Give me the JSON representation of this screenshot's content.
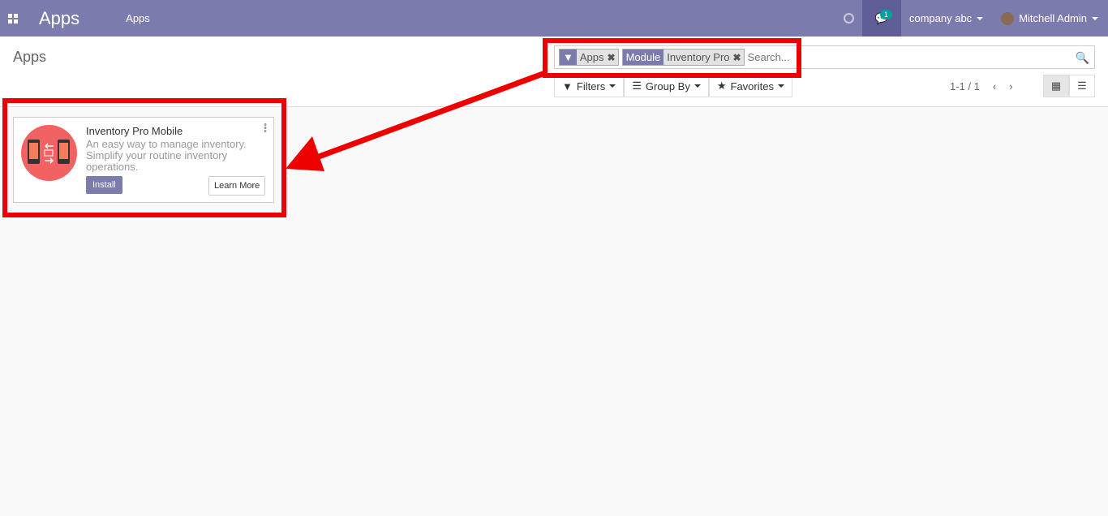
{
  "navbar": {
    "brand": "Apps",
    "menu": [
      "Apps"
    ],
    "chat_badge": "1",
    "company": "company abc",
    "user": "Mitchell Admin"
  },
  "control_panel": {
    "title": "Apps",
    "facets": [
      {
        "icon": "filter-icon",
        "value": "Apps"
      },
      {
        "key": "Module",
        "value": "Inventory Pro"
      }
    ],
    "search_placeholder": "Search...",
    "buttons": {
      "filters": "Filters",
      "group_by": "Group By",
      "favorites": "Favorites"
    },
    "pager": "1-1 / 1"
  },
  "card": {
    "title": "Inventory Pro Mobile",
    "description": "An easy way to manage inventory. Simplify your routine inventory operations.",
    "install": "Install",
    "learn_more": "Learn More"
  },
  "colors": {
    "brand": "#7c7bad",
    "annotation": "#ee0000",
    "logo_bg": "#f26262"
  }
}
